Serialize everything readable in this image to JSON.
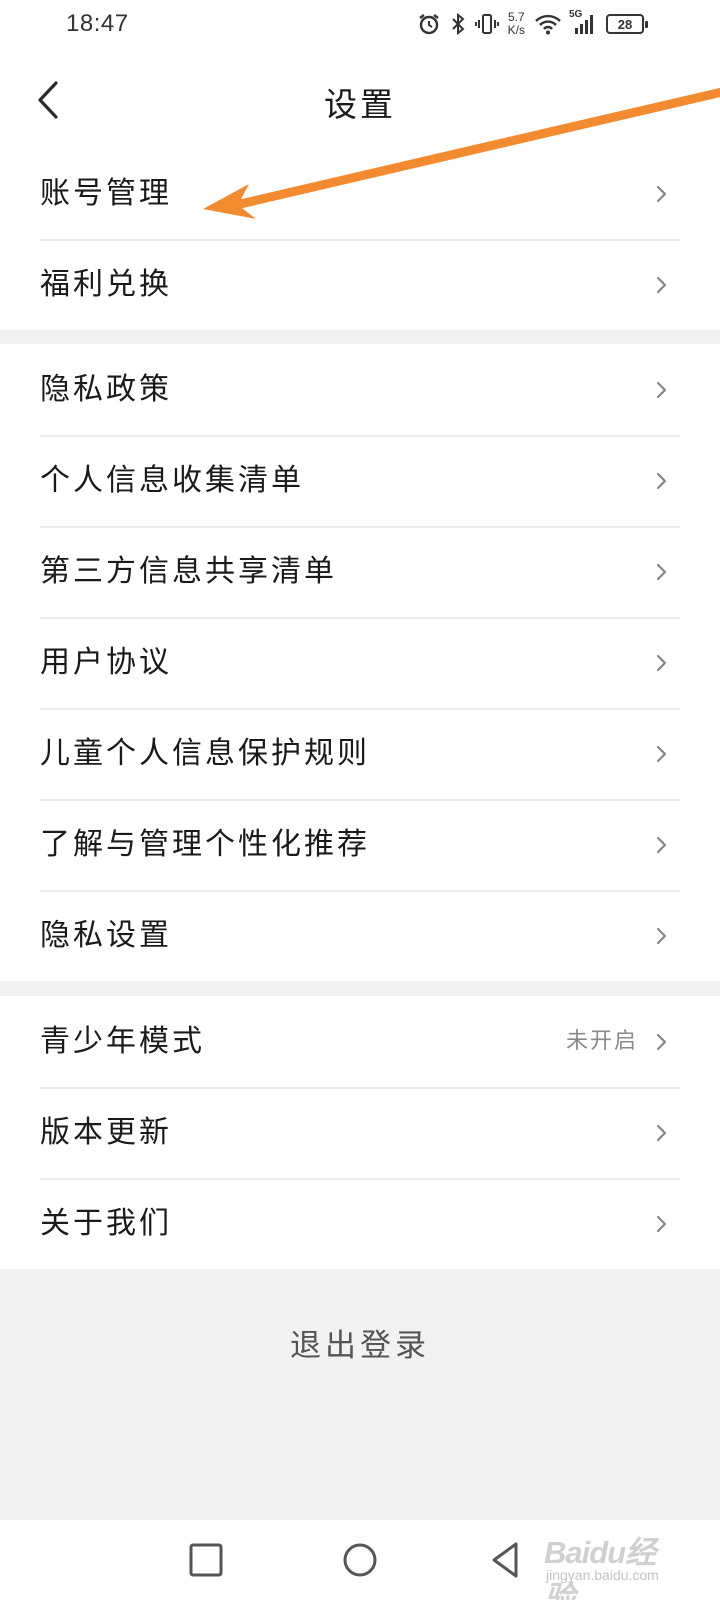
{
  "status_bar": {
    "time": "18:47",
    "net_speed_value": "5.7",
    "net_speed_unit": "K/s",
    "network_type": "5G",
    "battery": "28"
  },
  "header": {
    "title": "设置",
    "back_icon": "chevron-left-icon"
  },
  "groups": [
    {
      "items": [
        {
          "label": "账号管理"
        },
        {
          "label": "福利兑换"
        }
      ]
    },
    {
      "items": [
        {
          "label": "隐私政策"
        },
        {
          "label": "个人信息收集清单"
        },
        {
          "label": "第三方信息共享清单"
        },
        {
          "label": "用户协议"
        },
        {
          "label": "儿童个人信息保护规则"
        },
        {
          "label": "了解与管理个性化推荐"
        },
        {
          "label": "隐私设置"
        }
      ]
    },
    {
      "items": [
        {
          "label": "青少年模式",
          "value": "未开启"
        },
        {
          "label": "版本更新"
        },
        {
          "label": "关于我们"
        }
      ]
    }
  ],
  "logout": {
    "label": "退出登录"
  },
  "annotation": {
    "color": "#f28a30",
    "points_to": "账号管理"
  },
  "nav_bar": {
    "recent_icon": "square-icon",
    "home_icon": "circle-icon",
    "back_icon": "triangle-back-icon"
  },
  "watermark": {
    "logo": "Baidu经验",
    "sub": "jingyan.baidu.com"
  },
  "colors": {
    "background": "#f2f2f2",
    "surface": "#ffffff",
    "text": "#1a1a1a",
    "secondary_text": "#8a8a8a",
    "divider": "#ececec"
  }
}
